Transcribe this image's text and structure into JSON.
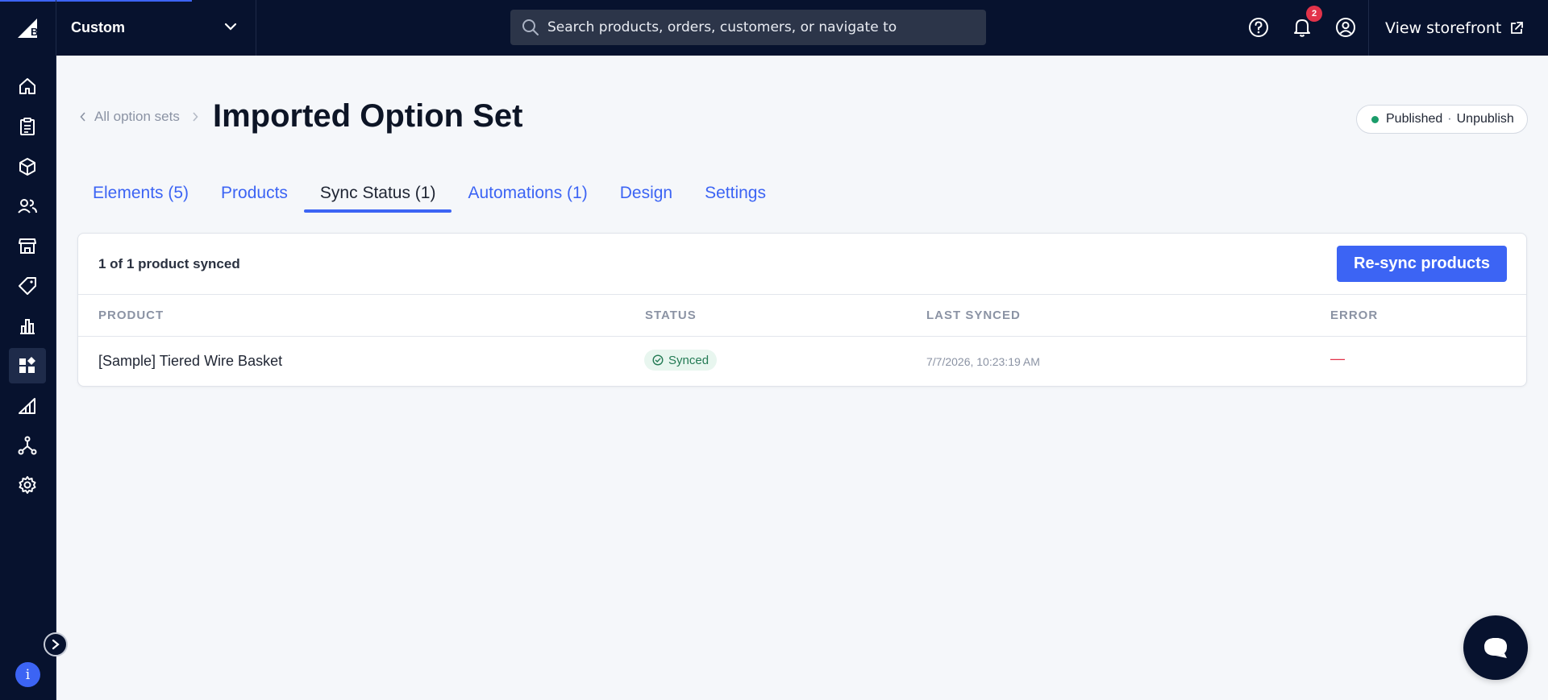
{
  "topbar": {
    "store_name": "Custom",
    "search_placeholder": "Search products, orders, customers, or navigate to",
    "notification_count": "2",
    "view_storefront": "View storefront"
  },
  "sidebar": {
    "items": [
      "home-icon",
      "orders-icon",
      "products-icon",
      "customers-icon",
      "storefront-icon",
      "marketing-icon",
      "analytics-icon",
      "apps-icon",
      "channels-icon",
      "integrations-icon",
      "settings-icon"
    ],
    "active_item": "apps-icon"
  },
  "header": {
    "breadcrumb": "All option sets",
    "title": "Imported Option Set",
    "publish_status": "Published",
    "publish_separator": "·",
    "unpublish_label": "Unpublish",
    "status_color": "#1a9c6a"
  },
  "tabs": [
    {
      "label": "Elements (5)",
      "active": false
    },
    {
      "label": "Products",
      "active": false
    },
    {
      "label": "Sync Status (1)",
      "active": true
    },
    {
      "label": "Automations (1)",
      "active": false
    },
    {
      "label": "Design",
      "active": false
    },
    {
      "label": "Settings",
      "active": false
    }
  ],
  "sync": {
    "summary": "1 of 1 product synced",
    "resync_label": "Re-sync products",
    "columns": {
      "product": "PRODUCT",
      "status": "STATUS",
      "last_synced": "LAST SYNCED",
      "error": "ERROR"
    },
    "rows": [
      {
        "product": "[Sample] Tiered Wire Basket",
        "status": "Synced",
        "last_synced": "7/7/2026, 10:23:19 AM",
        "error": "—"
      }
    ]
  },
  "colors": {
    "accent": "#3c64f4",
    "nav_bg": "#07122e",
    "error": "#e2334a"
  }
}
